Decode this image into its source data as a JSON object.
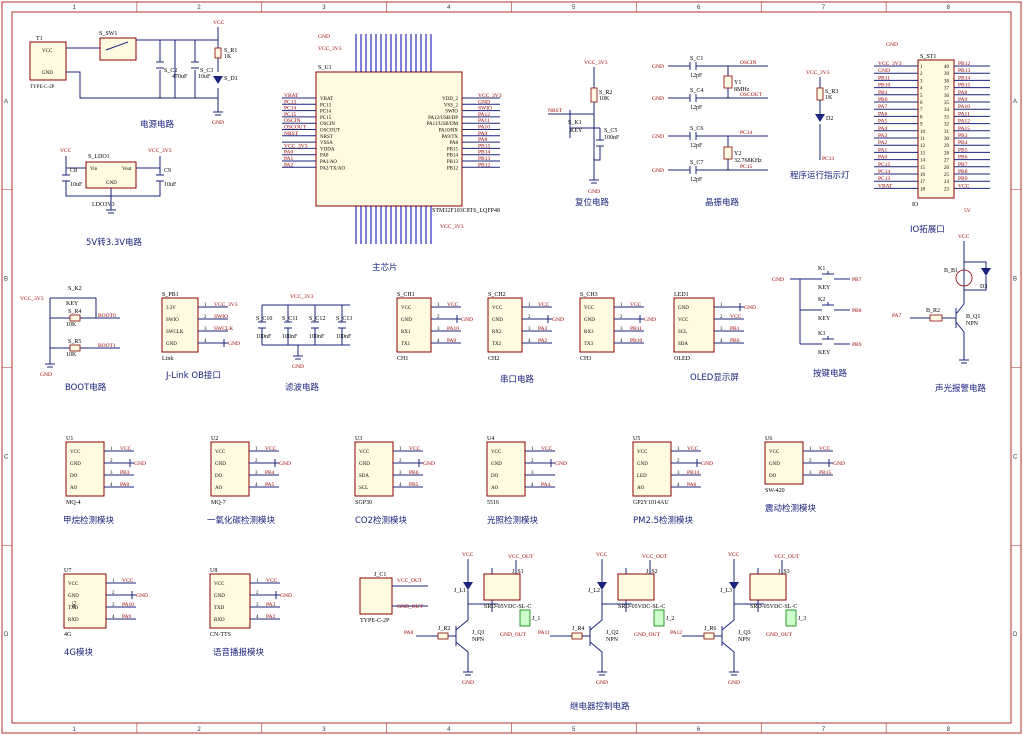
{
  "border": {
    "cols": [
      "1",
      "2",
      "3",
      "4",
      "5",
      "6",
      "7",
      "8"
    ],
    "rows": [
      "A",
      "B",
      "C",
      "D"
    ]
  },
  "sections": {
    "power": "电源电路",
    "ldo": "5V转3.3V电路",
    "mcu": "主芯片",
    "reset": "复位电路",
    "crystal": "晶振电路",
    "led": "程序运行指示灯",
    "io": "IO拓展口",
    "boot": "BOOT电路",
    "jlink": "J-Link OB接口",
    "filter": "滤波电路",
    "serial": "串口电路",
    "oled": "OLED显示屏",
    "keys": "按键电路",
    "alarm": "声光报警电路",
    "methane": "甲烷检测模块",
    "co": "一氧化碳检测模块",
    "co2": "CO2检测模块",
    "light": "光照检测模块",
    "pm25": "PM2.5检测模块",
    "vibration": "震动检测模块",
    "g4": "4G模块",
    "voice": "语音播报模块",
    "relay": "继电器控制电路"
  },
  "mcu": {
    "ref": "S_U1",
    "part": "STM32F103C8T6_LQFP48",
    "left_pins": [
      "VBAT",
      "PC13",
      "PC14",
      "PC15",
      "OSCIN",
      "OSCOUT",
      "NRST",
      "VSSA",
      "VDDA",
      "PA0",
      "PA1/AO",
      "PA2/TX/AO"
    ],
    "left_nets": [
      "VBAT",
      "PC13",
      "PC14",
      "PC15",
      "OSCIN",
      "OSCOUT",
      "NRST",
      "",
      "VCC_3V3",
      "PA0",
      "PA1",
      "PA2"
    ],
    "right_pins": [
      "VDD_2",
      "VSS_2",
      "SWIO",
      "PA12/USB/DP",
      "PA11/USB/DM",
      "PA10/RX",
      "PA9/TX",
      "PA8",
      "PB15",
      "PB14",
      "PB13",
      "PB12"
    ],
    "right_nets": [
      "VCC_3V3",
      "GND",
      "SWIO",
      "PA12",
      "PA11",
      "PA10",
      "PA9",
      "PA8",
      "PB15",
      "PB14",
      "PB13",
      "PB12"
    ],
    "vcc_net": "VCC_3V3",
    "gnd_net": "GND"
  },
  "power": {
    "conn_ref": "T1",
    "conn_part": "TYPE-C-2P",
    "conn_pins": [
      "VCC",
      "GND"
    ],
    "switch_ref": "S_SW1",
    "caps": [
      "S_C2",
      "S_C3"
    ],
    "cap_vals": [
      "470uF",
      "10uF"
    ],
    "resistor": "S_R1",
    "resistor_val": "1K",
    "led": "S_D1",
    "vcc": "VCC",
    "gnd": "GND"
  },
  "ldo": {
    "ref": "S_LDO1",
    "pins": [
      "Vin",
      "Vout",
      "GND"
    ],
    "part": "LDO3V3",
    "in_net": "VCC",
    "out_net": "VCC_3V3",
    "caps": [
      "C8",
      "C9"
    ],
    "cap_vals": [
      "10uF",
      "10uF"
    ]
  },
  "reset": {
    "net_top": "VCC_3V3",
    "resistor": "S_R2",
    "resistor_val": "10K",
    "net": "NRST",
    "key": "S_K1",
    "key_label": "KEY",
    "cap": "S_C5",
    "cap_val": "100nF",
    "gnd": "GND"
  },
  "crystal": {
    "caps": [
      "S_C1",
      "S_C4",
      "S_C6",
      "S_C7"
    ],
    "cap_vals": [
      "12pF",
      "12pF",
      "12pF",
      "12pF"
    ],
    "y1": "Y1",
    "y1_val": "8MHz",
    "y2": "Y2",
    "y2_val": "32.768KHz",
    "nets": [
      "OSCIN",
      "OSCOUT",
      "PC14",
      "PC15"
    ],
    "gnd": "GND"
  },
  "run_led": {
    "net": "VCC_3V3",
    "resistor": "S_R3",
    "resistor_val": "1K",
    "led": "D2",
    "ctrl": "PC13"
  },
  "io": {
    "ref": "S_ST1",
    "part": "IO",
    "left_nets": [
      "VCC_3V3",
      "GND",
      "PB11",
      "PB10",
      "PB1",
      "PB0",
      "PA7",
      "PA6",
      "PA5",
      "PA4",
      "PA3",
      "PA2",
      "PA1",
      "PA0",
      "PC15",
      "PC14",
      "PC13",
      "VBAT"
    ],
    "right_nets": [
      "PB12",
      "PB13",
      "PB14",
      "PB15",
      "PA8",
      "PA9",
      "PA10",
      "PA11",
      "PA12",
      "PA15",
      "PB3",
      "PB4",
      "PB5",
      "PB6",
      "PB7",
      "PB8",
      "PB9",
      "VCC"
    ],
    "gnd": "GND",
    "vcc5": "5V"
  },
  "boot": {
    "net_top": "VCC_3V3",
    "key": "S_K2",
    "key_label": "KEY",
    "r4": "S_R4",
    "r5": "S_R5",
    "rvals": [
      "10K",
      "10K"
    ],
    "nets": [
      "BOOT0",
      "BOOT1"
    ],
    "gnd": "GND"
  },
  "jlink": {
    "ref": "S_PB1",
    "pins": [
      "3.3V",
      "SWIO",
      "SWCLK",
      "GND"
    ],
    "nets": [
      "VCC_3V3",
      "SWIO",
      "SWCLK",
      "GND"
    ],
    "part": "Link"
  },
  "filter": {
    "net_top": "VCC_3V3",
    "caps": [
      "S_C10",
      "S_C11",
      "S_C12",
      "S_C13"
    ],
    "cap_vals": [
      "100nF",
      "100nF",
      "100nF",
      "100nF"
    ],
    "gnd": "GND"
  },
  "serial": [
    {
      "ref": "S_CH1",
      "part": "CH1",
      "pins": [
        "VCC",
        "GND",
        "RX1",
        "TX1"
      ],
      "nets": [
        "VCC",
        "GND",
        "PA10",
        "PA9"
      ]
    },
    {
      "ref": "S_CH2",
      "part": "CH2",
      "pins": [
        "VCC",
        "GND",
        "RX2",
        "TX2"
      ],
      "nets": [
        "VCC",
        "GND",
        "PA3",
        "PA2"
      ]
    },
    {
      "ref": "S_CH3",
      "part": "CH3",
      "pins": [
        "VCC",
        "GND",
        "RX3",
        "TX3"
      ],
      "nets": [
        "VCC",
        "GND",
        "PB11",
        "PB10"
      ]
    }
  ],
  "oled": {
    "ref": "LED1",
    "part": "OLED",
    "pins": [
      "GND",
      "VCC",
      "SCL",
      "SDA"
    ],
    "nets": [
      "GND",
      "VCC",
      "PB1",
      "PB0"
    ]
  },
  "keys": {
    "refs": [
      "K1",
      "K2",
      "K3"
    ],
    "label": "KEY",
    "nets": [
      "PB7",
      "PB8",
      "PB9"
    ],
    "gnd": "GND"
  },
  "alarm": {
    "buzzer": "B_B1",
    "led": "D3",
    "resistor": "B_R2",
    "transistor": "B_Q1",
    "transistor_type": "NPN",
    "ctrl": "PA7",
    "vcc": "VCC",
    "gnd": "GND"
  },
  "sensors": [
    {
      "ref": "U1",
      "part": "MQ-4",
      "pins": [
        "VCC",
        "GND",
        "DO",
        "AO"
      ],
      "nets": [
        "VCC",
        "GND",
        "PB3",
        "PA0"
      ]
    },
    {
      "ref": "U2",
      "part": "MQ-7",
      "pins": [
        "VCC",
        "GND",
        "DO",
        "AO"
      ],
      "nets": [
        "VCC",
        "GND",
        "PB4",
        "PA5"
      ]
    },
    {
      "ref": "U3",
      "part": "SGP30",
      "pins": [
        "VCC",
        "GND",
        "SDA",
        "SCL"
      ],
      "nets": [
        "VCC",
        "GND",
        "PB6",
        "PB5"
      ]
    },
    {
      "ref": "U4",
      "part": "5516",
      "pins": [
        "VCC",
        "GND",
        "DO",
        "AO"
      ],
      "nets": [
        "VCC",
        "GND",
        "",
        "PA4"
      ]
    },
    {
      "ref": "U5",
      "part": "GP2Y1014AU",
      "pins": [
        "VCC",
        "GND",
        "LED",
        "AO"
      ],
      "nets": [
        "VCC",
        "GND",
        "PB14",
        "PA6"
      ]
    },
    {
      "ref": "U6",
      "part": "SW-420",
      "pins": [
        "VCC",
        "GND",
        "DO"
      ],
      "nets": [
        "VCC",
        "GND",
        "PB15"
      ]
    }
  ],
  "g4": {
    "ref": "U7",
    "part": "4G",
    "label": "4G",
    "pins": [
      "VCC",
      "GND",
      "TXD",
      "RXD"
    ],
    "nets": [
      "VCC",
      "GND",
      "PA10",
      "PA9"
    ]
  },
  "voice": {
    "ref": "U8",
    "part": "CN-TTS",
    "pins": [
      "VCC",
      "GND",
      "TXD",
      "RXD"
    ],
    "nets": [
      "VCC",
      "GND",
      "PA3",
      "PA2"
    ]
  },
  "relay": {
    "conn_ref": "J_C1",
    "conn_part": "TYPE-C-2P",
    "conn_nets": [
      "VCC_OUT",
      "GND_OUT"
    ],
    "channels": [
      {
        "led": "J_L1",
        "relay": "J_S1",
        "rpart": "SRD-05VDC-SL-C",
        "r": "J_R2",
        "q": "J_Q1",
        "ctrl": "PA8",
        "out": "J_1"
      },
      {
        "led": "J_L2",
        "relay": "J_S2",
        "rpart": "SRD-05VDC-SL-C",
        "r": "J_R4",
        "q": "J_Q2",
        "ctrl": "PA11",
        "out": "J_2"
      },
      {
        "led": "J_L3",
        "relay": "J_S3",
        "rpart": "SRD-05VDC-SL-C",
        "r": "J_R6",
        "q": "J_Q3",
        "ctrl": "PA12",
        "out": "J_3"
      }
    ],
    "qtype": "NPN",
    "vcc": "VCC",
    "vcc_out": "VCC_OUT",
    "gnd_out": "GND_OUT",
    "gnd": "GND"
  },
  "colors": {
    "frame": "#b03030",
    "wire": "#1a237e",
    "body": "#fffbe0",
    "caption": "#1a237e",
    "net": "#a00000"
  }
}
